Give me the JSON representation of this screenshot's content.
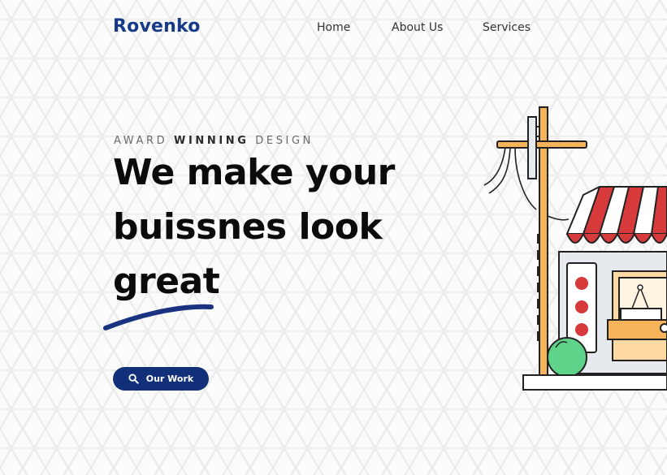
{
  "header": {
    "logo": "Rovenko",
    "nav": [
      "Home",
      "About Us",
      "Services"
    ]
  },
  "hero": {
    "eyebrow_pre": "AWARD",
    "eyebrow_bold": "WINNING",
    "eyebrow_post": "DESIGN",
    "headline_lines": [
      "We make your",
      "buissnes look",
      "great"
    ],
    "cta_label": "Our Work",
    "cta_icon": "search-icon"
  },
  "colors": {
    "brand": "#163a8a",
    "button": "#12307a",
    "awning_red": "#d63a3a",
    "wood": "#f6b35a",
    "bush": "#5fd38a"
  }
}
